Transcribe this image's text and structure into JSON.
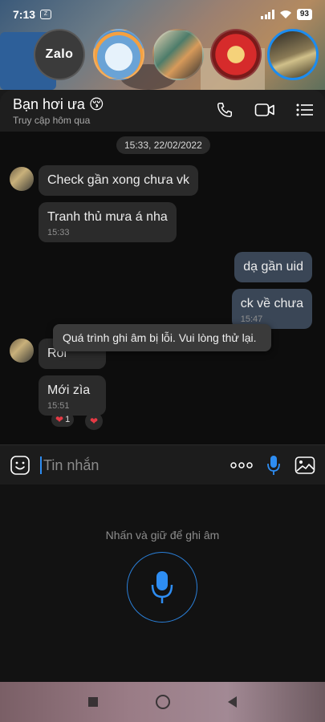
{
  "status_bar": {
    "time": "7:13",
    "app_badge": "Zalo",
    "battery": "93"
  },
  "chat_heads": {
    "zalo_label": "Zalo"
  },
  "header": {
    "name": "Bạn hơi ưa 😚",
    "subtitle": "Truy cập hôm qua"
  },
  "chat": {
    "date": "15:33, 22/02/2022",
    "messages": [
      {
        "text": "Check gần xong chưa vk"
      },
      {
        "text": "Tranh thủ mưa á nha",
        "time": "15:33"
      },
      {
        "text": "dạ gần uid"
      },
      {
        "text": "ck về chưa",
        "time": "15:47"
      },
      {
        "text": "Rồi"
      },
      {
        "text": "Mới zìa",
        "time": "15:51"
      }
    ],
    "reaction_count": "1",
    "toast": "Quá trình ghi âm bị lỗi. Vui lòng thử lại."
  },
  "input": {
    "placeholder": "Tin nhắn"
  },
  "voice": {
    "hint": "Nhấn và giữ để ghi âm"
  },
  "colors": {
    "accent": "#2e8df2",
    "heart": "#e53a45"
  }
}
